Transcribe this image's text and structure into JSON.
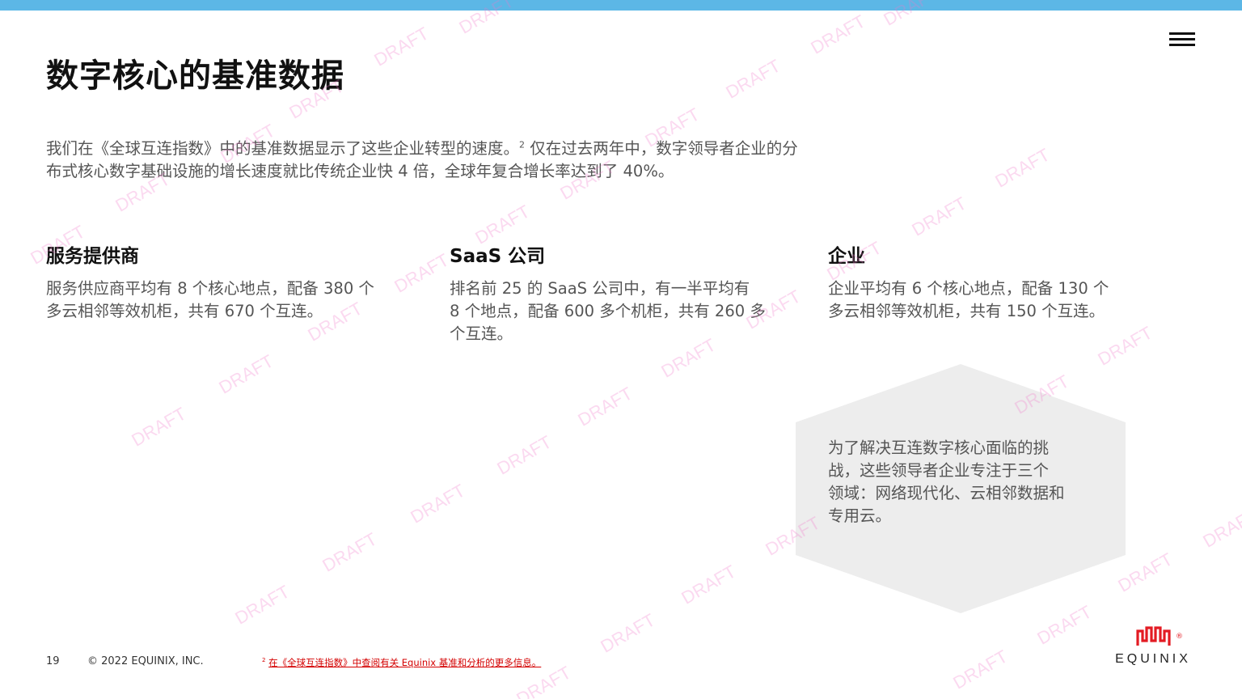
{
  "page": {
    "title": "数字核心的基准数据",
    "intro_text": "我们在《全球互连指数》中的基准数据显示了这些企业转型的速度。",
    "intro_sup": "2",
    "intro_text_2": " 仅在过去两年中，数字领导者企业的分布式核心数字基础设施的增长速度就比传统企业快 4 倍，全球年复合增长率达到了 40%。"
  },
  "columns": [
    {
      "title": "服务提供商",
      "body_lines": [
        "服务供应商平均有 8 个核心地点，配备 380 个",
        "多云相邻等效机柜，共有 670 个互连。"
      ]
    },
    {
      "title": "SaaS 公司",
      "body_lines": [
        "排名前 25 的 SaaS 公司中，有一半平均有",
        "8 个地点，配备 600 多个机柜，共有 260 多",
        "个互连。"
      ]
    },
    {
      "title": "企业",
      "body_lines": [
        "企业平均有 6 个核心地点，配备 130 个",
        "多云相邻等效机柜，共有 150 个互连。"
      ]
    }
  ],
  "callout": {
    "lines": [
      "为了解决互连数字核心面临的挑",
      "战，这些领导者企业专注于三个",
      "领域：网络现代化、云相邻数据和",
      "专用云。"
    ]
  },
  "footer": {
    "page_number": "19",
    "copyright": "© 2022 EQUINIX, INC.",
    "note_sup": "2",
    "note_text": "在《全球互连指数》中查阅有关 Equinix 基准和分析的更多信息。"
  },
  "logo": {
    "text": "EQUINIX",
    "registered": "®"
  },
  "watermark": {
    "text": "DRAFT"
  },
  "colors": {
    "top_bar": "#5cb7e6",
    "link": "#d40000",
    "logo_red": "#e31b23",
    "hexagon": "#ededed"
  },
  "icons": {
    "menu": "hamburger-menu-icon"
  }
}
